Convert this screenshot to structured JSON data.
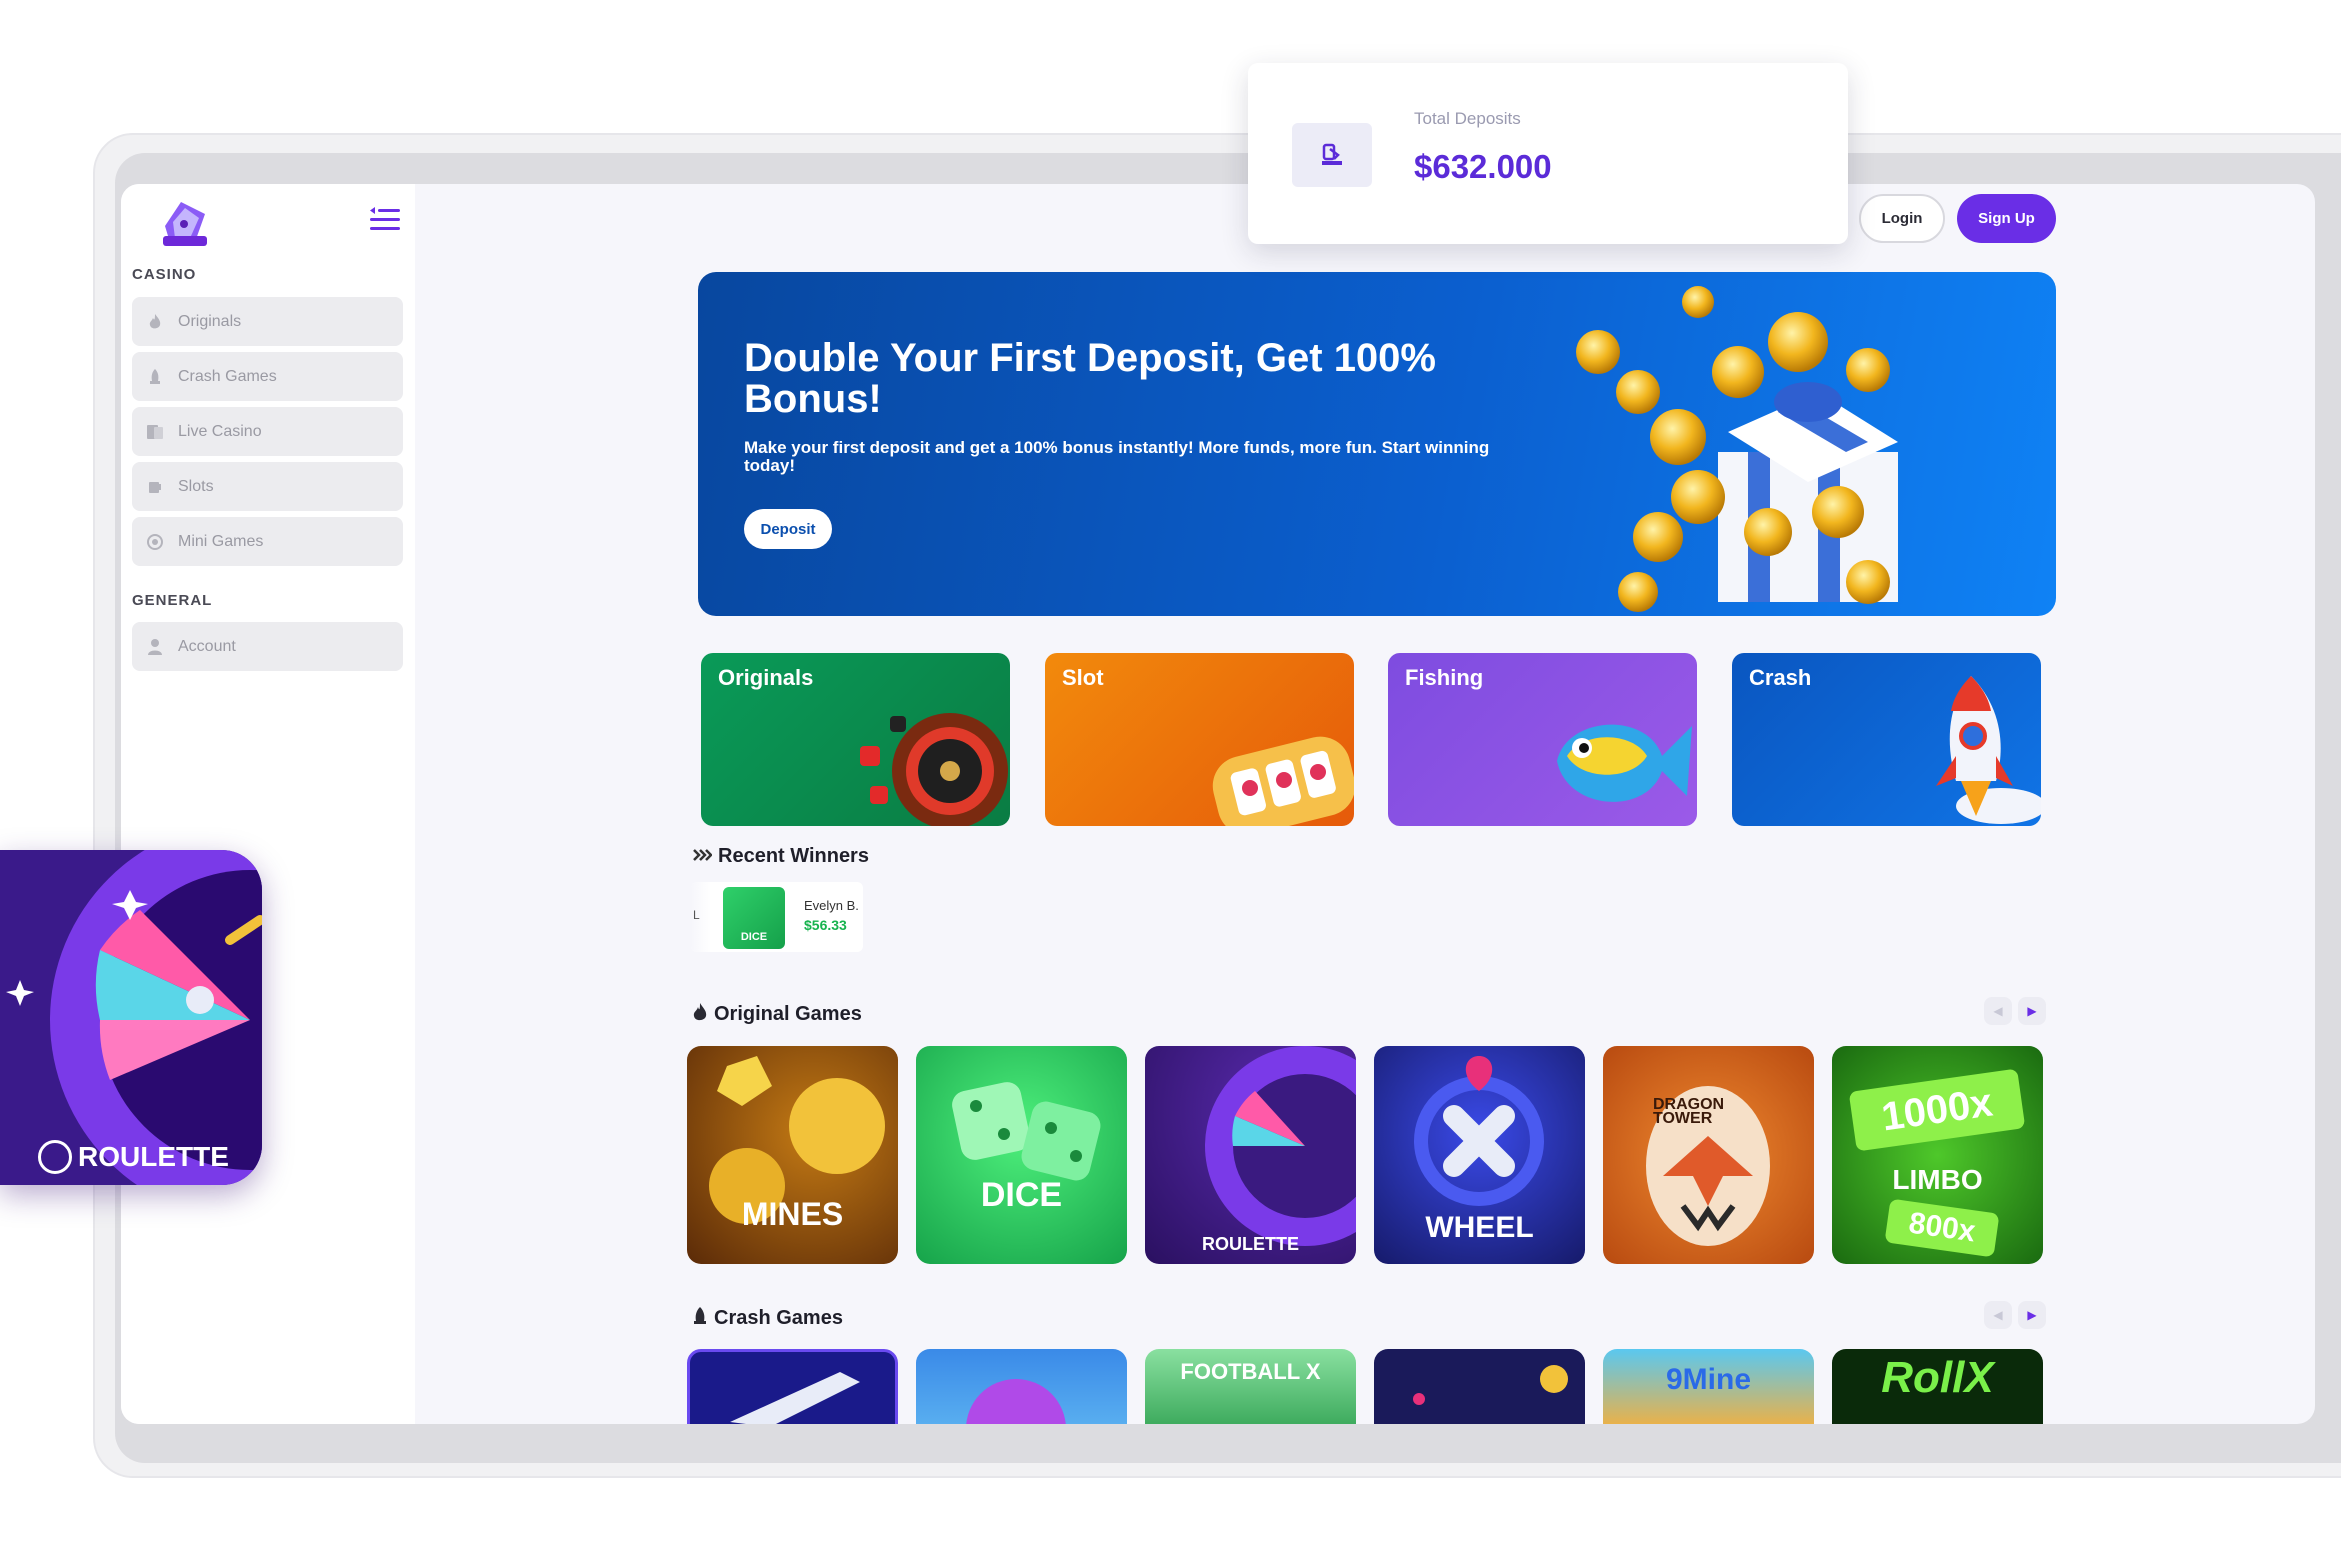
{
  "float_card": {
    "label": "Total Deposits",
    "value": "$632.000",
    "icon": "deposit-icon"
  },
  "sidebar": {
    "logo": "casino-logo",
    "casino_heading": "CASINO",
    "general_heading": "GENERAL",
    "items": [
      {
        "label": "Originals",
        "icon": "flame-icon"
      },
      {
        "label": "Crash Games",
        "icon": "rocket-icon"
      },
      {
        "label": "Live Casino",
        "icon": "cards-icon"
      },
      {
        "label": "Slots",
        "icon": "slot-icon"
      },
      {
        "label": "Mini Games",
        "icon": "globe-icon"
      }
    ],
    "account": {
      "label": "Account",
      "icon": "user-icon"
    }
  },
  "header": {
    "login": "Login",
    "signup": "Sign Up"
  },
  "banner": {
    "title": "Double Your First Deposit, Get 100% Bonus!",
    "subtitle": "Make your first deposit and get a 100% bonus instantly! More funds, more fun. Start winning today!",
    "button": "Deposit"
  },
  "categories": [
    {
      "label": "Originals",
      "color": "#0f8a4e"
    },
    {
      "label": "Slot",
      "color": "#f07a10"
    },
    {
      "label": "Fishing",
      "color": "#8a52e0"
    },
    {
      "label": "Crash",
      "color": "#0d5fc8"
    }
  ],
  "recent_winners": {
    "title": "Recent Winners",
    "entries": [
      {
        "game": "DICE",
        "name": "Evelyn B.",
        "amount": "$56.33"
      }
    ]
  },
  "original_games": {
    "title": "Original Games",
    "tiles": [
      "MINES",
      "DICE",
      "ROULETTE",
      "WHEEL",
      "DRAGON TOWER",
      "LIMBO"
    ],
    "limbo_top": "1000x",
    "limbo_bottom": "800x"
  },
  "crash_games": {
    "title": "Crash Games",
    "tiles": [
      "",
      "",
      "FOOTBALL X",
      "",
      "9Mine",
      "RollX"
    ]
  },
  "app_icon": {
    "label": "ROULETTE"
  }
}
